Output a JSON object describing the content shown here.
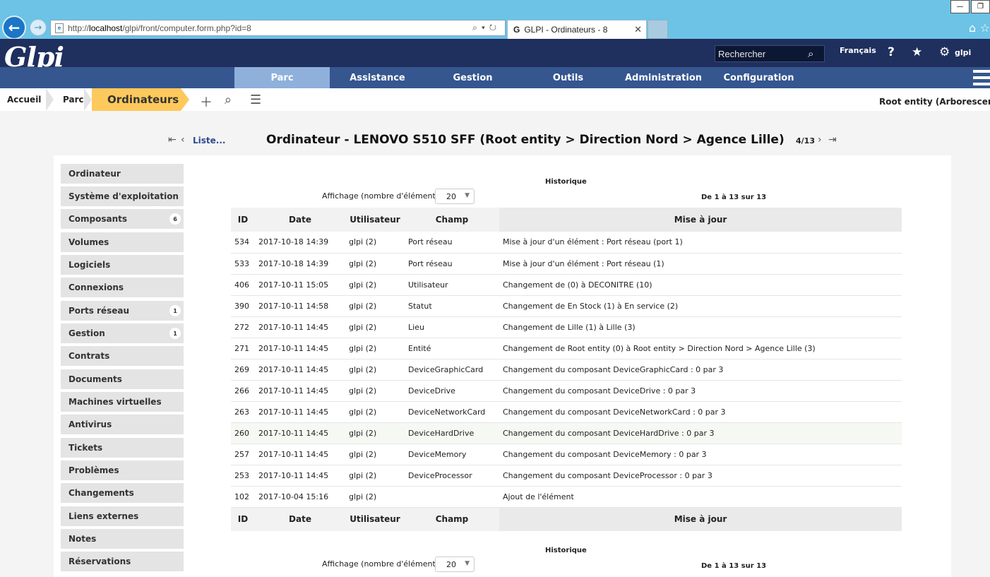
{
  "browser": {
    "url_prefix": "http://",
    "url_host": "localhost",
    "url_path": "/glpi/front/computer.form.php?id=8",
    "tab_title": "GLPI - Ordinateurs - 8",
    "tab_icon": "G"
  },
  "header": {
    "logo": "Glpi",
    "search_placeholder": "Rechercher",
    "language": "Français",
    "help": "?",
    "user": "glpi"
  },
  "menu": [
    "Parc",
    "Assistance",
    "Gestion",
    "Outils",
    "Administration",
    "Configuration"
  ],
  "breadcrumb": {
    "home": "Accueil",
    "section": "Parc",
    "current": "Ordinateurs"
  },
  "entity": "Root entity (Arborescence)",
  "pager": {
    "list_link": "Liste...",
    "position": "4/13"
  },
  "page_title": "Ordinateur - LENOVO S510 SFF (Root entity > Direction Nord > Agence Lille)",
  "sidebar": [
    {
      "label": "Ordinateur",
      "count": ""
    },
    {
      "label": "Système d'exploitation",
      "count": ""
    },
    {
      "label": "Composants",
      "count": "6"
    },
    {
      "label": "Volumes",
      "count": ""
    },
    {
      "label": "Logiciels",
      "count": ""
    },
    {
      "label": "Connexions",
      "count": ""
    },
    {
      "label": "Ports réseau",
      "count": "1"
    },
    {
      "label": "Gestion",
      "count": "1"
    },
    {
      "label": "Contrats",
      "count": ""
    },
    {
      "label": "Documents",
      "count": ""
    },
    {
      "label": "Machines virtuelles",
      "count": ""
    },
    {
      "label": "Antivirus",
      "count": ""
    },
    {
      "label": "Tickets",
      "count": ""
    },
    {
      "label": "Problèmes",
      "count": ""
    },
    {
      "label": "Changements",
      "count": ""
    },
    {
      "label": "Liens externes",
      "count": ""
    },
    {
      "label": "Notes",
      "count": ""
    },
    {
      "label": "Réservations",
      "count": ""
    }
  ],
  "history": {
    "title": "Historique",
    "display_label": "Affichage (nombre d'éléments)",
    "display_value": "20",
    "range": "De 1 à 13 sur 13",
    "columns": [
      "ID",
      "Date",
      "Utilisateur",
      "Champ",
      "Mise à jour"
    ],
    "rows": [
      [
        "534",
        "2017-10-18 14:39",
        "glpi (2)",
        "Port réseau",
        "Mise à jour d'un élément : Port réseau (port 1)"
      ],
      [
        "533",
        "2017-10-18 14:39",
        "glpi (2)",
        "Port réseau",
        "Mise à jour d'un élément : Port réseau (1)"
      ],
      [
        "406",
        "2017-10-11 15:05",
        "glpi (2)",
        "Utilisateur",
        "Changement de   (0) à DECONITRE (10)"
      ],
      [
        "390",
        "2017-10-11 14:58",
        "glpi (2)",
        "Statut",
        "Changement de En Stock (1) à En service (2)"
      ],
      [
        "272",
        "2017-10-11 14:45",
        "glpi (2)",
        "Lieu",
        "Changement de Lille (1) à Lille (3)"
      ],
      [
        "271",
        "2017-10-11 14:45",
        "glpi (2)",
        "Entité",
        "Changement de Root entity (0) à Root entity > Direction Nord > Agence Lille (3)"
      ],
      [
        "269",
        "2017-10-11 14:45",
        "glpi (2)",
        "DeviceGraphicCard",
        "Changement du composant DeviceGraphicCard : 0 par 3"
      ],
      [
        "266",
        "2017-10-11 14:45",
        "glpi (2)",
        "DeviceDrive",
        "Changement du composant DeviceDrive : 0 par 3"
      ],
      [
        "263",
        "2017-10-11 14:45",
        "glpi (2)",
        "DeviceNetworkCard",
        "Changement du composant DeviceNetworkCard : 0 par 3"
      ],
      [
        "260",
        "2017-10-11 14:45",
        "glpi (2)",
        "DeviceHardDrive",
        "Changement du composant DeviceHardDrive : 0 par 3"
      ],
      [
        "257",
        "2017-10-11 14:45",
        "glpi (2)",
        "DeviceMemory",
        "Changement du composant DeviceMemory : 0 par 3"
      ],
      [
        "253",
        "2017-10-11 14:45",
        "glpi (2)",
        "DeviceProcessor",
        "Changement du composant DeviceProcessor : 0 par 3"
      ],
      [
        "102",
        "2017-10-04 15:16",
        "glpi (2)",
        "",
        "Ajout de l'élément"
      ]
    ]
  }
}
